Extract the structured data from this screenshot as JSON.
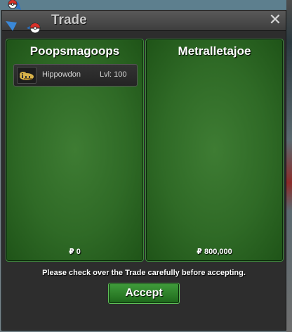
{
  "window": {
    "title": "Trade",
    "close_symbol": "✕"
  },
  "left_panel": {
    "trader_name": "Poopsmagoops",
    "items": [
      {
        "name": "Hippowdon",
        "level": "Lvl: 100",
        "icon": "hippowdon-sprite-icon"
      }
    ],
    "money": "₽ 0"
  },
  "right_panel": {
    "trader_name": "Metralletajoe",
    "items": [],
    "money": "₽ 800,000"
  },
  "footer": {
    "notice": "Please check over the Trade carefully before accepting.",
    "accept_label": "Accept"
  },
  "colors": {
    "panel_green": "#2f6a26",
    "button_green": "#2f8a2b",
    "titlebar": "#4a4a4a"
  }
}
